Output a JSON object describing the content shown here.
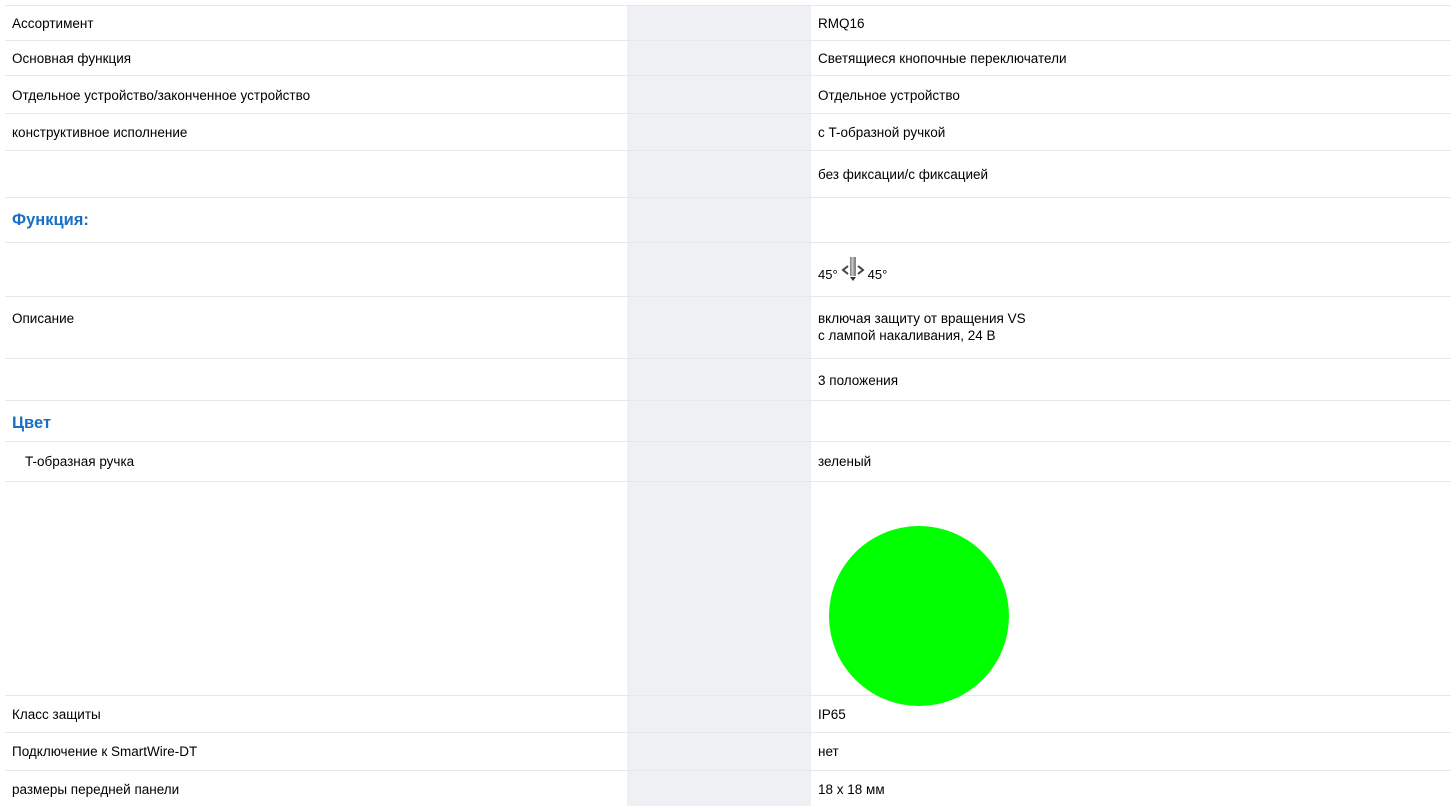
{
  "rows": [
    {
      "label": "Ассортимент",
      "value": "RMQ16"
    },
    {
      "label": "Основная функция",
      "value": "Светящиеся кнопочные переключатели"
    },
    {
      "label": "Отдельное устройство/законченное устройство",
      "value": "Отдельное устройство"
    },
    {
      "label": "конструктивное исполнение",
      "value": "с T-образной ручкой"
    },
    {
      "label": "",
      "value": "без фиксации/с фиксацией"
    }
  ],
  "section_function": "Функция:",
  "function_symbol": {
    "left_angle": "45°",
    "right_angle": "45°",
    "icon": "t-handle-switch-icon"
  },
  "description": {
    "label": "Описание",
    "line1": "включая защиту от вращения VS",
    "line2": "с лампой накаливания, 24 В"
  },
  "positions": "3 положения",
  "section_color": "Цвет",
  "handle": {
    "label": "T-образная ручка",
    "value": "зеленый"
  },
  "color_swatch": {
    "color": "#00ff00",
    "icon": "green-color-swatch"
  },
  "bottom_rows": [
    {
      "label": "Класс защиты",
      "value": "IP65"
    },
    {
      "label": "Подключение к SmartWire-DT",
      "value": "нет"
    },
    {
      "label": "размеры передней панели",
      "value": "18 x 18 мм"
    }
  ]
}
